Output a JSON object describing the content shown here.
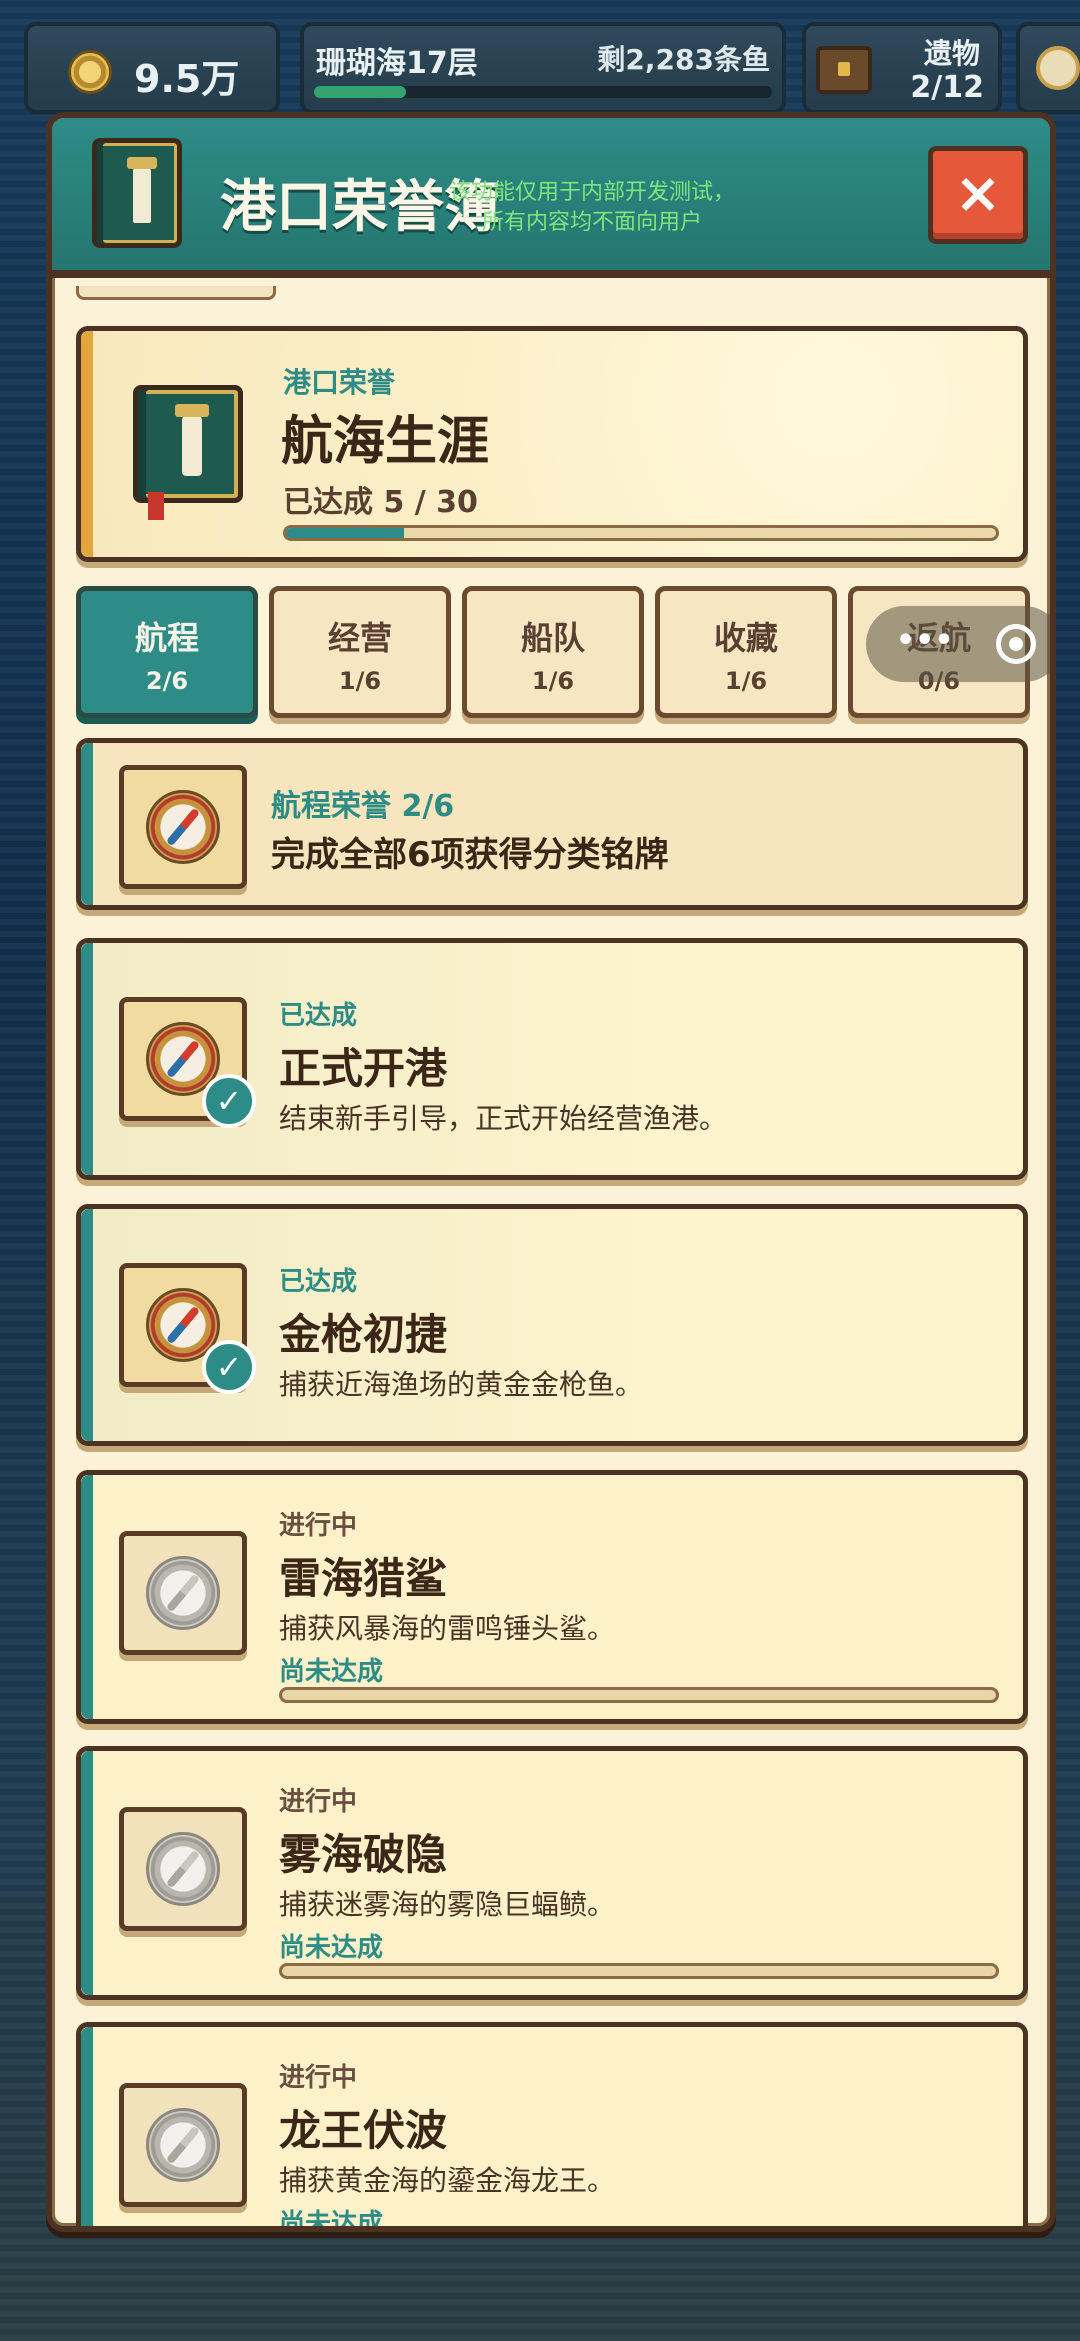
{
  "hud": {
    "coins": "9.5万",
    "sea_title": "珊瑚海17层",
    "sea_remaining": "剩2,283条鱼",
    "relic_label": "遗物",
    "relic_count": "2/12"
  },
  "modal": {
    "title": "港口荣誉簿",
    "dev_note_line1": "该功能仅用于内部开发测试，",
    "dev_note_line2": "所有内容均不面向用户",
    "close_label": "×"
  },
  "summary": {
    "subtitle": "港口荣誉",
    "title": "航海生涯",
    "progress_text": "已达成 5 / 30",
    "progress_fraction": 0.1667
  },
  "tabs": [
    {
      "label": "航程",
      "count": "2/6",
      "active": true
    },
    {
      "label": "经营",
      "count": "1/6",
      "active": false
    },
    {
      "label": "船队",
      "count": "1/6",
      "active": false
    },
    {
      "label": "收藏",
      "count": "1/6",
      "active": false
    },
    {
      "label": "返航",
      "count": "0/6",
      "active": false
    }
  ],
  "category_header": {
    "title": "航程荣誉 2/6",
    "desc": "完成全部6项获得分类铭牌"
  },
  "achievements": [
    {
      "status": "已达成",
      "title": "正式开港",
      "desc": "结束新手引导，正式开始经营渔港。",
      "done": true
    },
    {
      "status": "已达成",
      "title": "金枪初捷",
      "desc": "捕获近海渔场的黄金金枪鱼。",
      "done": true
    },
    {
      "status": "进行中",
      "title": "雷海猎鲨",
      "desc": "捕获风暴海的雷鸣锤头鲨。",
      "pending": "尚未达成",
      "done": false
    },
    {
      "status": "进行中",
      "title": "雾海破隐",
      "desc": "捕获迷雾海的雾隐巨蝠鲼。",
      "pending": "尚未达成",
      "done": false
    },
    {
      "status": "进行中",
      "title": "龙王伏波",
      "desc": "捕获黄金海的鎏金海龙王。",
      "pending": "尚未达成",
      "done": false
    }
  ],
  "colors": {
    "teal": "#2e8c86",
    "parchment": "#fbf2d8",
    "border_brown": "#4b3222",
    "close_red": "#e5583a"
  }
}
